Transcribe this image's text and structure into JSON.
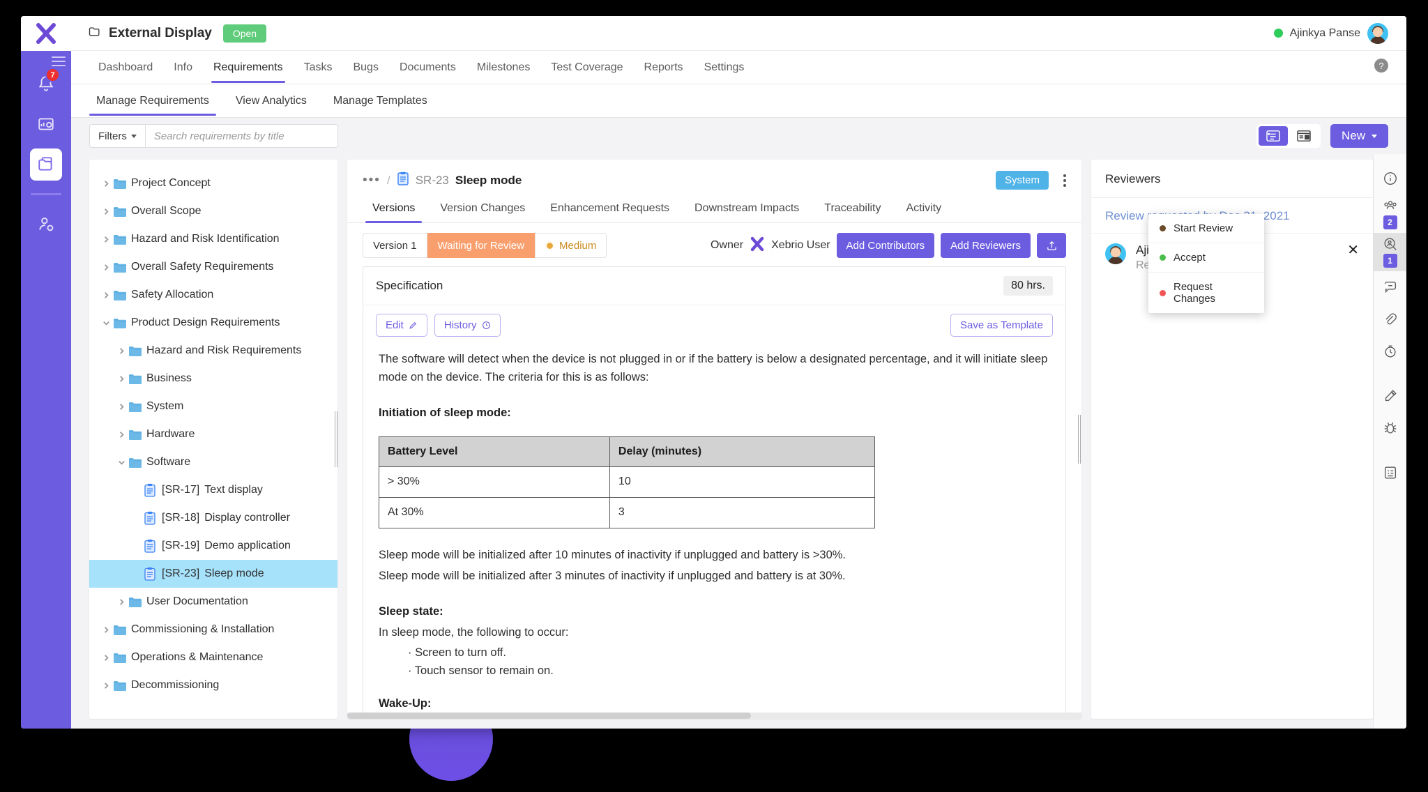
{
  "window": {
    "project_title": "External Display",
    "project_status": "Open",
    "user_name": "Ajinkya Panse"
  },
  "nav_tabs": [
    {
      "label": "Dashboard",
      "active": false
    },
    {
      "label": "Info",
      "active": false
    },
    {
      "label": "Requirements",
      "active": true
    },
    {
      "label": "Tasks",
      "active": false
    },
    {
      "label": "Bugs",
      "active": false
    },
    {
      "label": "Documents",
      "active": false
    },
    {
      "label": "Milestones",
      "active": false
    },
    {
      "label": "Test Coverage",
      "active": false
    },
    {
      "label": "Reports",
      "active": false
    },
    {
      "label": "Settings",
      "active": false
    }
  ],
  "sub_tabs": [
    {
      "label": "Manage Requirements",
      "active": true
    },
    {
      "label": "View Analytics",
      "active": false
    },
    {
      "label": "Manage Templates",
      "active": false
    }
  ],
  "filter_bar": {
    "filters_label": "Filters",
    "search_placeholder": "Search requirements by title",
    "search_value": "",
    "new_label": "New"
  },
  "tree": [
    {
      "label": "Project Concept",
      "depth": 0,
      "type": "folder",
      "expanded": false
    },
    {
      "label": "Overall Scope",
      "depth": 0,
      "type": "folder",
      "expanded": false
    },
    {
      "label": "Hazard and Risk Identification",
      "depth": 0,
      "type": "folder",
      "expanded": false
    },
    {
      "label": "Overall Safety Requirements",
      "depth": 0,
      "type": "folder",
      "expanded": false
    },
    {
      "label": "Safety Allocation",
      "depth": 0,
      "type": "folder",
      "expanded": false
    },
    {
      "label": "Product Design Requirements",
      "depth": 0,
      "type": "folder",
      "expanded": true
    },
    {
      "label": "Hazard and Risk Requirements",
      "depth": 1,
      "type": "folder",
      "expanded": false
    },
    {
      "label": "Business",
      "depth": 1,
      "type": "folder",
      "expanded": false
    },
    {
      "label": "System",
      "depth": 1,
      "type": "folder",
      "expanded": false
    },
    {
      "label": "Hardware",
      "depth": 1,
      "type": "folder",
      "expanded": false
    },
    {
      "label": "Software",
      "depth": 1,
      "type": "folder",
      "expanded": true
    },
    {
      "id": "[SR-17]",
      "label": "Text display",
      "depth": 2,
      "type": "doc",
      "selected": false
    },
    {
      "id": "[SR-18]",
      "label": "Display controller",
      "depth": 2,
      "type": "doc",
      "selected": false
    },
    {
      "id": "[SR-19]",
      "label": "Demo application",
      "depth": 2,
      "type": "doc",
      "selected": false
    },
    {
      "id": "[SR-23]",
      "label": "Sleep mode",
      "depth": 2,
      "type": "doc",
      "selected": true
    },
    {
      "label": "User Documentation",
      "depth": 1,
      "type": "folder",
      "expanded": false
    },
    {
      "label": "Commissioning & Installation",
      "depth": 0,
      "type": "folder",
      "expanded": false
    },
    {
      "label": "Operations & Maintenance",
      "depth": 0,
      "type": "folder",
      "expanded": false
    },
    {
      "label": "Decommissioning",
      "depth": 0,
      "type": "folder",
      "expanded": false
    }
  ],
  "detail": {
    "breadcrumb_dots": "•••",
    "breadcrumb_slash": "/",
    "breadcrumb_id": "SR-23",
    "breadcrumb_title": "Sleep mode",
    "system_chip": "System",
    "tabs": [
      {
        "label": "Versions",
        "active": true
      },
      {
        "label": "Version Changes",
        "active": false
      },
      {
        "label": "Enhancement Requests",
        "active": false
      },
      {
        "label": "Downstream Impacts",
        "active": false
      },
      {
        "label": "Traceability",
        "active": false
      },
      {
        "label": "Activity",
        "active": false
      }
    ],
    "version": "Version 1",
    "status": "Waiting for Review",
    "priority": "Medium",
    "owner_label": "Owner",
    "owner_name": "Xebrio User",
    "add_contributors": "Add Contributors",
    "add_reviewers": "Add Reviewers"
  },
  "spec": {
    "title": "Specification",
    "hours": "80 hrs.",
    "edit_label": "Edit",
    "history_label": "History",
    "save_template_label": "Save as Template",
    "intro": "The software will detect when the device is not plugged in or if the battery is below a designated percentage, and it will initiate sleep mode on the device. The criteria for this is as follows:",
    "heading_initiation": "Initiation of sleep mode:",
    "table": {
      "headers": [
        "Battery Level",
        "Delay (minutes)"
      ],
      "rows": [
        [
          "> 30%",
          "10"
        ],
        [
          "At 30%",
          "3"
        ]
      ]
    },
    "line1": "Sleep mode will be initialized after 10 minutes of inactivity if unplugged and battery is  >30%.",
    "line2": "Sleep mode will be initialized after 3 minutes of inactivity if unplugged and battery is at 30%.",
    "heading_sleep_state": "Sleep state:",
    "sleep_state_intro": "In sleep mode, the following to occur:",
    "sleep_state_items": [
      "Screen to turn off.",
      "Touch sensor to remain on."
    ],
    "heading_wakeup": "Wake-Up:"
  },
  "reviewers": {
    "panel_title": "Reviewers",
    "requested_by": "Review requested by Dec 31, 2021",
    "name": "Ajinkya Panse",
    "status": "Review Requested",
    "menu": [
      {
        "label": "Start Review",
        "color": "#6b4b2a"
      },
      {
        "label": "Accept",
        "color": "#4bbd4b"
      },
      {
        "label": "Request Changes",
        "color": "#f25555"
      }
    ]
  },
  "right_rail": [
    {
      "icon": "info-icon",
      "badge": null,
      "active": false
    },
    {
      "icon": "contributors-icon",
      "badge": "2",
      "active": false
    },
    {
      "icon": "reviewers-icon",
      "badge": "1",
      "active": true
    },
    {
      "icon": "comments-icon",
      "badge": null,
      "active": false
    },
    {
      "icon": "attachment-icon",
      "badge": null,
      "active": false
    },
    {
      "icon": "time-icon",
      "badge": null,
      "active": false
    },
    {
      "icon": "tasks-icon",
      "badge": null,
      "active": false
    },
    {
      "icon": "bugs-icon",
      "badge": null,
      "active": false
    },
    {
      "icon": "notes-icon",
      "badge": null,
      "active": false
    }
  ],
  "left_rail": {
    "notifications_badge": "7"
  },
  "colors": {
    "brand_purple": "#6c5ce0",
    "status_green": "#5ecc7a",
    "status_orange": "#f99f6e",
    "system_blue": "#4fb3e8",
    "selected_row": "#a7e2fb"
  }
}
